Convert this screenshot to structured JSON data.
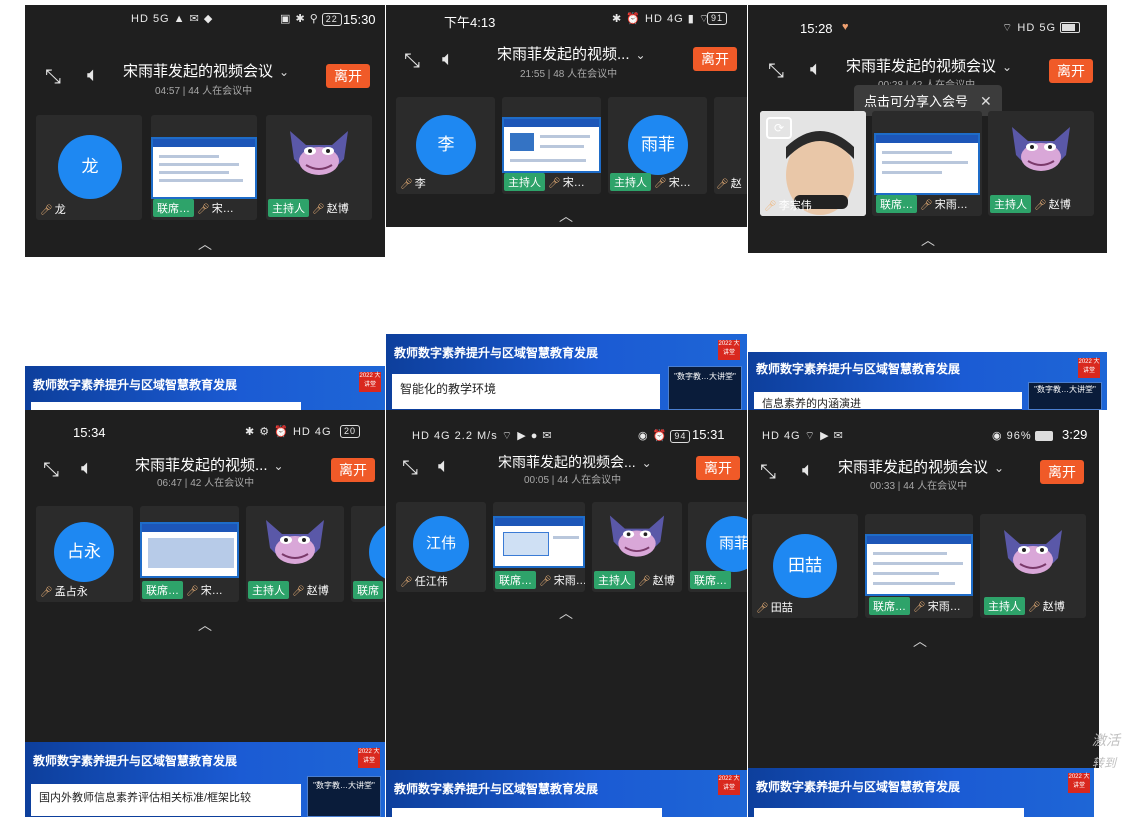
{
  "meeting_title": "宋雨菲发起的视频会议",
  "meeting_title_short": "宋雨菲发起的视频...",
  "meeting_title_short2": "宋雨菲发起的视频会...",
  "leave_label": "离开",
  "panels": [
    {
      "status_time": "15:30",
      "battery": "22",
      "status_icons": "HD 5G ▲ ✉ ◆",
      "duration": "04:57",
      "participants": "44 人在会议中"
    },
    {
      "status_time": "下午4:13",
      "battery": "91",
      "status_icons": "✱ ⏰ HD 4G ▮ ⌔",
      "duration": "21:55",
      "participants": "48 人在会议中"
    },
    {
      "status_time": "15:28",
      "battery": "",
      "status_icons": "⌔ HD 5G",
      "duration": "00:28",
      "participants": "42 人在会议中"
    },
    {
      "status_time": "15:34",
      "battery": "20",
      "status_icons": "✱ ⚙ ⏰ HD 4G",
      "duration": "06:47",
      "participants": "42 人在会议中"
    },
    {
      "status_time": "15:31",
      "battery": "94",
      "status_icons": "HD 4G 2.2 M/s ⌔ ▶ ● ✉",
      "duration": "00:05",
      "participants": "44 人在会议中"
    },
    {
      "status_time": "3:29",
      "battery": "96%",
      "status_icons": "HD 4G ⌔ ▶ ✉",
      "duration": "00:33",
      "participants": "44 人在会议中"
    }
  ],
  "tiles": {
    "p1": {
      "avatar": "龙",
      "name1": "龙",
      "tag_seat": "联席…",
      "name2": "宋…",
      "tag_host": "主持人",
      "name3": "赵博"
    },
    "p2": {
      "avatar1": "李",
      "name1": "李",
      "tag_host": "主持人",
      "name2": "宋…",
      "avatar2": "雨菲",
      "name3": "宋…",
      "name4": "赵"
    },
    "p3": {
      "name1": "李宗伟",
      "tag_seat": "联席…",
      "name2": "宋雨…",
      "tag_host": "主持人",
      "name3": "赵博",
      "tooltip": "点击可分享入会号"
    },
    "p4": {
      "avatar": "占永",
      "name1": "孟占永",
      "tag_seat": "联席…",
      "name2": "宋…",
      "tag_host": "主持人",
      "name3": "赵博",
      "tag_seat2": "联席"
    },
    "p5": {
      "avatar": "江伟",
      "name1": "任江伟",
      "tag_seat": "联席…",
      "name2": "宋雨…",
      "tag_host": "主持人",
      "name3": "赵博",
      "avatar2": "雨菲",
      "tag_seat2": "联席…"
    },
    "p6": {
      "avatar": "田喆",
      "name1": "田喆",
      "tag_seat": "联席…",
      "name2": "宋雨…",
      "tag_host": "主持人",
      "name3": "赵博"
    }
  },
  "slides": {
    "title": "教师数字素养提升与区域智慧教育发展",
    "badge": "2022 大讲堂",
    "video_label": "\"数字教…大讲堂\"",
    "s2_content": "智能化的教学环境",
    "s3_content": "信息素养的内涵演进",
    "s4_content": "国内外教师信息素养评估相关标准/框架比较"
  },
  "side_text": {
    "line1": "激活",
    "line2": "转到"
  },
  "colors": {
    "leave": "#f05a28",
    "avatar": "#1e88f2",
    "host_tag": "#2ea36a",
    "slide_blue": "#1b5bd4"
  }
}
